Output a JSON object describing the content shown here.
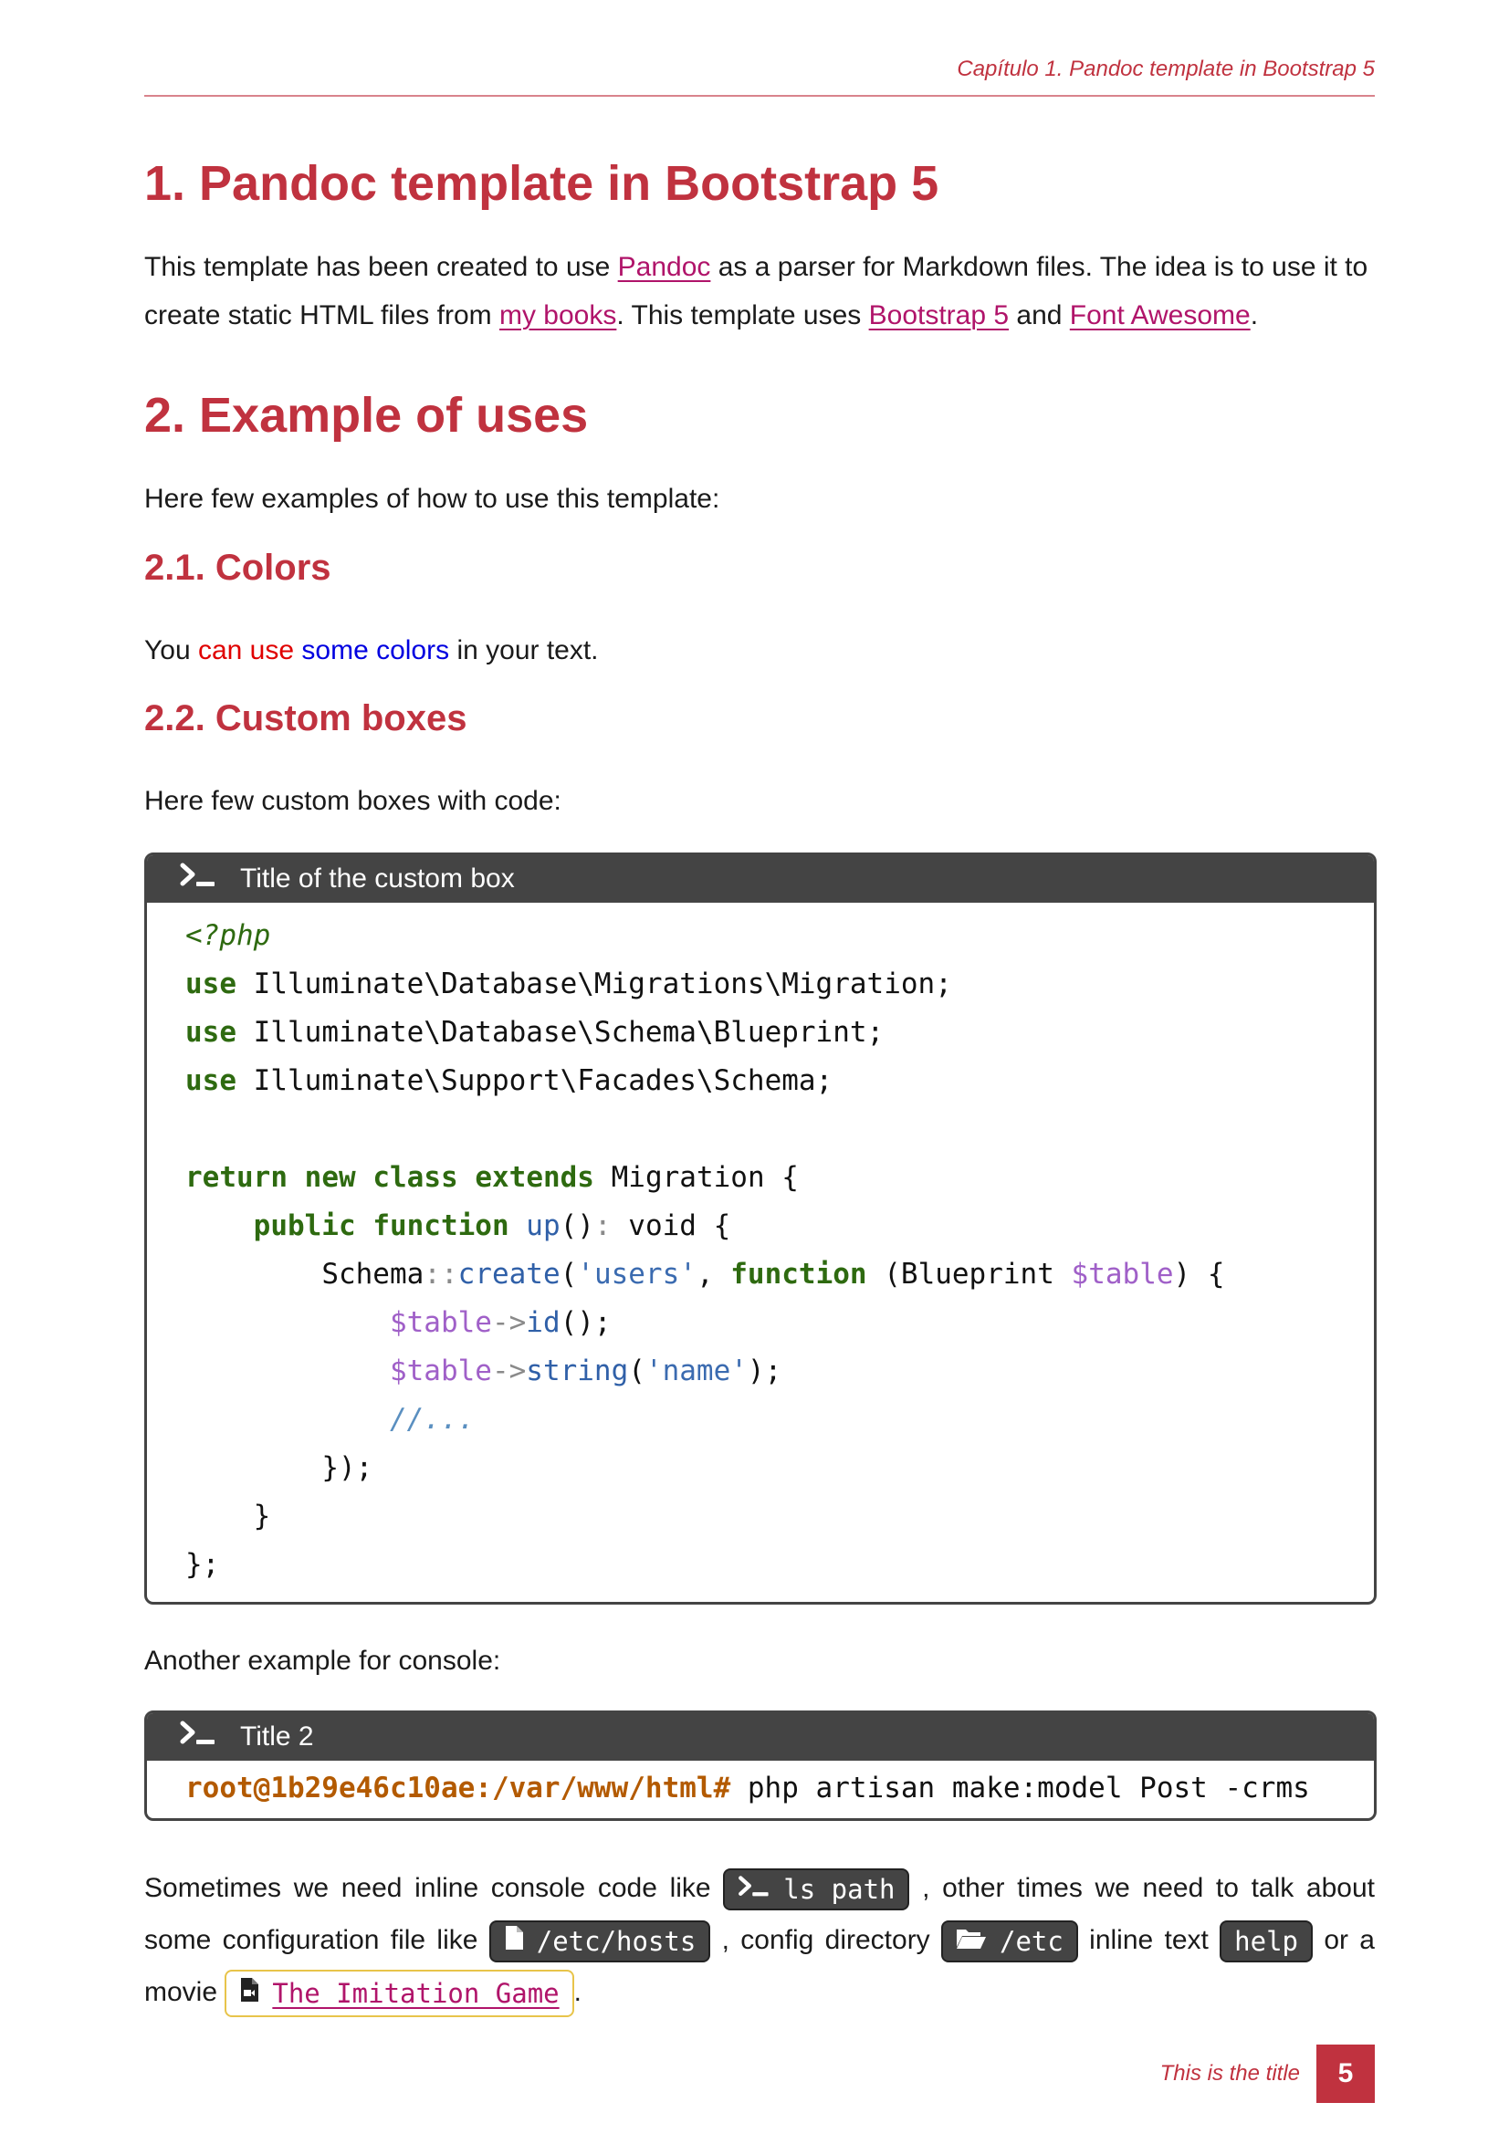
{
  "running_header": "Capítulo 1.  Pandoc template in Bootstrap 5",
  "section1": {
    "heading": "1. Pandoc template in Bootstrap 5",
    "p_before_pandoc": "This template has been created to use ",
    "link_pandoc": "Pandoc",
    "p_after_pandoc": " as a parser for Markdown files. The idea is to use it to create static HTML files from ",
    "link_books": "my books",
    "p_after_books": ". This template uses ",
    "link_bootstrap": "Bootstrap 5",
    "p_and": " and ",
    "link_fa": "Font Awesome",
    "p_end": "."
  },
  "section2": {
    "heading": "2. Example of uses",
    "intro": "Here few examples of how to use this template:"
  },
  "section21": {
    "heading": "2.1. Colors",
    "t1": "You ",
    "red_text": "can use",
    "t2": " ",
    "blue_text": "some colors",
    "t3": " in your text."
  },
  "section22": {
    "heading": "2.2. Custom boxes",
    "intro": "Here few custom boxes with code:"
  },
  "box1": {
    "title": "Title of the custom box",
    "code": {
      "l1": "<?php",
      "use": "use",
      "ns1": " Illuminate\\Database\\Migrations\\Migration;",
      "ns2": " Illuminate\\Database\\Schema\\Blueprint;",
      "ns3": " Illuminate\\Support\\Facades\\Schema;",
      "kw_return": "return",
      "kw_new": "new",
      "kw_class": "class",
      "kw_extends": "extends",
      "migration": " Migration {",
      "kw_public": "public",
      "kw_function": "function",
      "fn_up": "up",
      "up_tail": "()",
      "colon": ":",
      "void": " void {",
      "schema": "Schema",
      "dcolon": "::",
      "fn_create": "create",
      "paren_open": "(",
      "str_users": "'users'",
      "comma": ", ",
      "blueprint": " (Blueprint ",
      "var_table": "$table",
      "close_brace": ") {",
      "arrow": "->",
      "fn_id": "id",
      "id_tail": "();",
      "fn_string": "string",
      "str_name": "'name'",
      "string_tail": ");",
      "comment": "//...",
      "close_fn": "});",
      "close_method": "}",
      "close_class": "};"
    }
  },
  "console_intro": "Another example for console:",
  "box2": {
    "title": "Title 2",
    "prompt": "root@1b29e46c10ae:/var/www/html#",
    "command": " php artisan make:model Post -crms"
  },
  "inline": {
    "t1": "Sometimes we need inline console code like ",
    "console_chip": "ls path",
    "t2": " , other times we need to talk about some configuration file like ",
    "file_chip": "/etc/hosts",
    "t3": " , config directory ",
    "dir_chip": "/etc",
    "t4": " inline text ",
    "text_chip": "help",
    "t5": " or a movie ",
    "movie_chip": "The Imitation Game",
    "t6": "."
  },
  "footer": {
    "title": "This is the title",
    "page_number": "5"
  },
  "icons": {
    "terminal": "terminal-icon",
    "file": "file-icon",
    "folder": "folder-open-icon",
    "movie": "file-video-icon"
  },
  "colors": {
    "accent": "#c0323f",
    "link": "#b0146a",
    "box": "#444444"
  }
}
